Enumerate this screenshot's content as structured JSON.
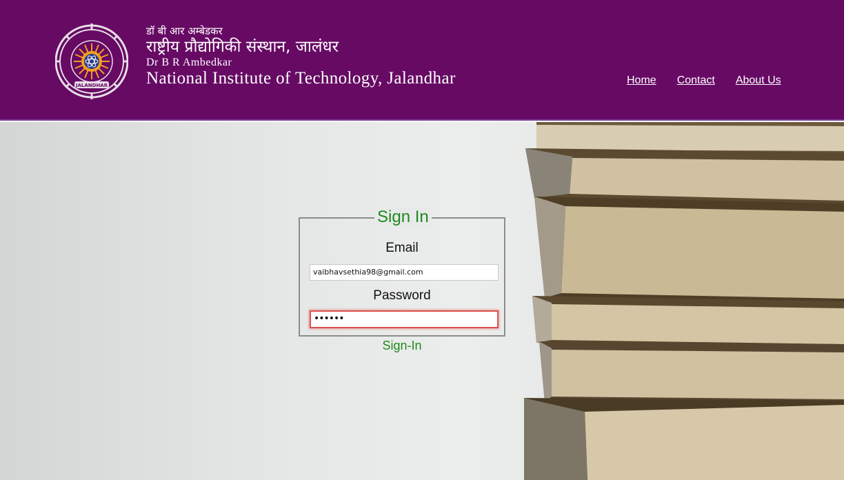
{
  "header": {
    "hindi_small": "डॉ बी आर अम्बेडकर",
    "hindi_large": "राष्ट्रीय प्रौद्योगिकी संस्थान, जालंधर",
    "english_small": "Dr B R Ambedkar",
    "english_large": "National Institute of Technology, Jalandhar",
    "logo_text": "JALANDHAR",
    "bg_color": "#670a64"
  },
  "nav": {
    "items": [
      {
        "label": "Home"
      },
      {
        "label": "Contact"
      },
      {
        "label": "About Us"
      }
    ]
  },
  "form": {
    "legend": "Sign In",
    "email_label": "Email",
    "email_value": "vaibhavsethia98@gmail.com",
    "password_label": "Password",
    "password_value": "••••••",
    "submit_label": "Sign-In",
    "accent_color": "#1e8a1e"
  }
}
